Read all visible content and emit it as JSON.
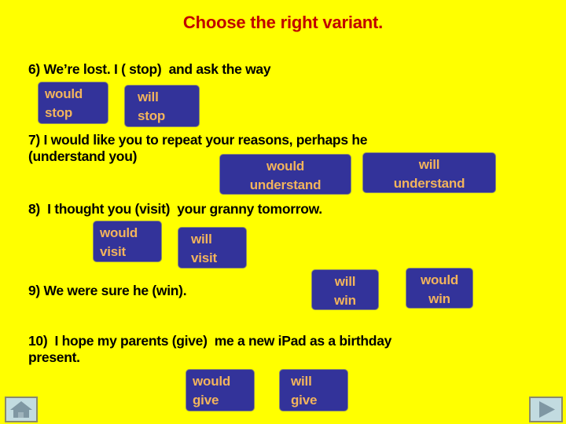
{
  "slide": {
    "background_color": "#ffff00",
    "title": "Choose the right variant.",
    "title_color": "#c00000"
  },
  "theme": {
    "option_fill": "#33339a",
    "option_text_color": "#f2b45c",
    "option_border": "#8a8a6a",
    "nav_fill": "#c2dbe0",
    "question_text_color": "#000000"
  },
  "questions": [
    {
      "number": "6)",
      "text": "6) We’re lost. I ( stop)  and ask the way",
      "options": [
        {
          "line1": "would",
          "line2": "stop"
        },
        {
          "line1": "will",
          "line2": "stop"
        }
      ]
    },
    {
      "number": "7)",
      "text": "7) I would like you to repeat your reasons, perhaps he\n(understand you)",
      "options": [
        {
          "line1": "would",
          "line2": "understand"
        },
        {
          "line1": "will",
          "line2": "understand"
        }
      ]
    },
    {
      "number": "8)",
      "text": "8)  I thought you (visit)  your granny tomorrow.",
      "options": [
        {
          "line1": "would",
          "line2": "visit"
        },
        {
          "line1": "will",
          "line2": "visit"
        }
      ]
    },
    {
      "number": "9)",
      "text": "9) We were sure he (win).",
      "options": [
        {
          "line1": "will",
          "line2": "win"
        },
        {
          "line1": "would",
          "line2": "win"
        }
      ]
    },
    {
      "number": "10)",
      "text": "10)  I hope my parents (give)  me a new iPad as a birthday\npresent.",
      "options": [
        {
          "line1": "would",
          "line2": "give"
        },
        {
          "line1": "will",
          "line2": "give"
        }
      ]
    }
  ],
  "nav": {
    "home_icon": "home-icon",
    "next_icon": "play-triangle-icon"
  }
}
